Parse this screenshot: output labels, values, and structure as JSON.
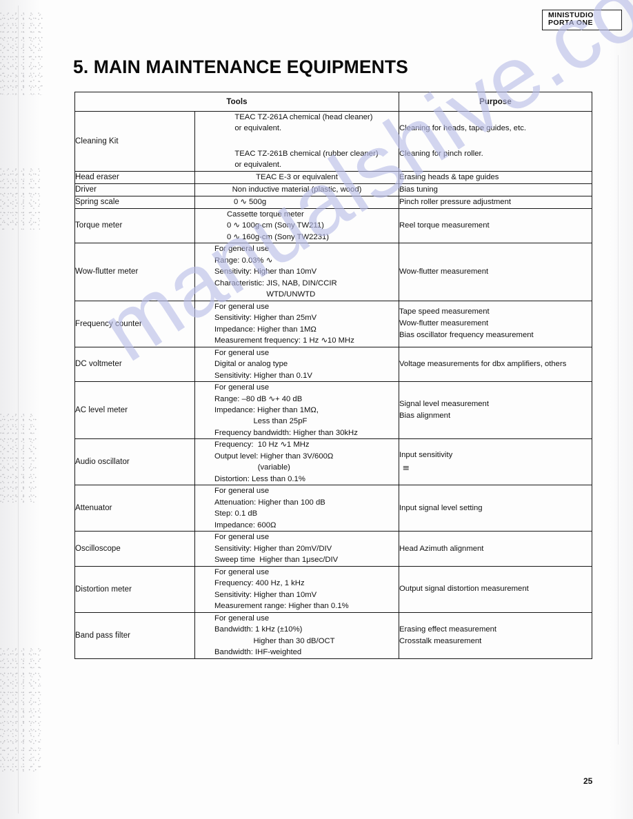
{
  "header": {
    "badge_line1": "MINISTUDIO",
    "badge_line2": "PORTA ONE"
  },
  "section": {
    "title": "5. MAIN MAINTENANCE EQUIPMENTS"
  },
  "table": {
    "columns": [
      "Tools",
      "Purpose"
    ],
    "rows": [
      {
        "tool": "Cleaning Kit",
        "spec_group_1": [
          "TEAC TZ-261A chemical (head cleaner)",
          "or equivalent."
        ],
        "spec_group_2": [
          "TEAC TZ-261B chemical (rubber cleaner)",
          "or equivalent."
        ],
        "purpose_group_1": [
          "Cleaning for heads, tape guides, etc."
        ],
        "purpose_group_2": [
          "Cleaning for pinch roller."
        ]
      },
      {
        "tool": "Head eraser",
        "spec": [
          "TEAC E-3 or equivalent"
        ],
        "purpose": [
          "Erasing heads & tape guides"
        ]
      },
      {
        "tool": "Driver",
        "spec": [
          "Non inductive material (plastic, wood)"
        ],
        "purpose": [
          "Bias tuning"
        ]
      },
      {
        "tool": "Spring scale",
        "spec": [
          "0 ∿ 500g"
        ],
        "purpose": [
          "Pinch roller pressure adjustment"
        ]
      },
      {
        "tool": "Torque meter",
        "spec": [
          "Cassette torque meter",
          "0 ∿ 100g-cm (Sony TW211)",
          "0 ∿ 160g-cm (Sony TW2231)"
        ],
        "purpose": [
          "Reel torque measurement"
        ]
      },
      {
        "tool": "Wow-flutter meter",
        "spec": [
          "For general use",
          "Range: 0.03% ∿",
          "Sensitivity: Higher than 10mV",
          "Characteristic: JIS, NAB, DIN/CCIR",
          "                        WTD/UNWTD"
        ],
        "purpose": [
          "Wow-flutter measurement"
        ]
      },
      {
        "tool": "Frequency counter",
        "spec": [
          "For general use",
          "Sensitivity: Higher than 25mV",
          "Impedance: Higher than 1MΩ",
          "Measurement frequency: 1 Hz ∿10 MHz"
        ],
        "purpose": [
          "Tape speed measurement",
          "Wow-flutter measurement",
          "Bias oscillator frequency measurement"
        ]
      },
      {
        "tool": "DC voltmeter",
        "spec": [
          "For general use",
          "Digital or analog type",
          "Sensitivity: Higher than 0.1V"
        ],
        "purpose": [
          "Voltage measurements for dbx amplifiers, others"
        ]
      },
      {
        "tool": "AC level meter",
        "spec": [
          "For general use",
          "Range: –80 dB ∿+ 40 dB",
          "Impedance: Higher than 1MΩ,",
          "                  Less than 25pF",
          "Frequency bandwidth: Higher than 30kHz"
        ],
        "purpose": [
          "Signal level measurement",
          "Bias alignment"
        ]
      },
      {
        "tool": "Audio oscillator",
        "spec": [
          "Frequency:  10 Hz ∿1 MHz",
          "Output level: Higher than 3V/600Ω",
          "                    (variable)",
          "Distortion: Less than 0.1%"
        ],
        "purpose": [
          "Input sensitivity"
        ],
        "purpose_smudge": "≡"
      },
      {
        "tool": "Attenuator",
        "spec": [
          "For general use",
          "Attenuation: Higher than 100 dB",
          "Step: 0.1 dB",
          "Impedance: 600Ω"
        ],
        "purpose": [
          "Input signal level setting"
        ]
      },
      {
        "tool": "Oscilloscope",
        "spec": [
          "For general use",
          "Sensitivity: Higher than 20mV/DIV",
          "Sweep time  Higher than 1μsec/DIV"
        ],
        "purpose": [
          "Head Azimuth alignment"
        ]
      },
      {
        "tool": "Distortion meter",
        "spec": [
          "For general use",
          "Frequency: 400 Hz, 1 kHz",
          "Sensitivity: Higher than 10mV",
          "Measurement range: Higher than 0.1%"
        ],
        "purpose": [
          "Output signal distortion measurement"
        ]
      },
      {
        "tool": "Band pass filter",
        "spec": [
          "For general use",
          "Bandwidth: 1 kHz (±10%)",
          "                  Higher than 30 dB/OCT",
          "Bandwidth: IHF-weighted"
        ],
        "purpose": [
          "Erasing effect measurement",
          "Crosstalk measurement"
        ]
      }
    ]
  },
  "watermark": {
    "text": "manualshive.com"
  },
  "footer": {
    "page_number": "25"
  }
}
